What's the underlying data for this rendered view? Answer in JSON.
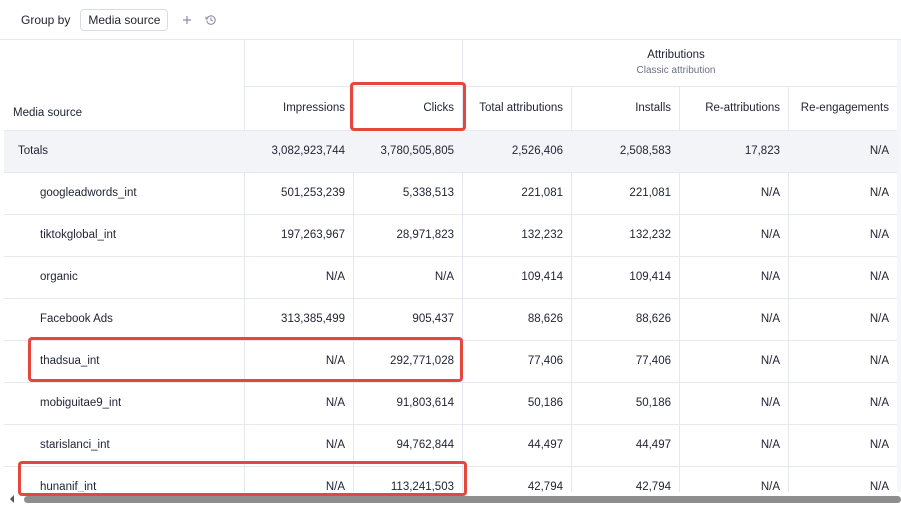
{
  "toolbar": {
    "group_by_label": "Group by",
    "group_by_value": "Media source",
    "add_icon": "plus-icon",
    "history_icon": "history-icon"
  },
  "table": {
    "attributions_title": "Attributions",
    "attributions_subtitle": "Classic attribution",
    "columns": {
      "media_source": "Media source",
      "impressions": "Impressions",
      "clicks": "Clicks",
      "total_attributions": "Total attributions",
      "installs": "Installs",
      "re_attributions": "Re-attributions",
      "re_engagements": "Re-engagements"
    },
    "totals": {
      "label": "Totals",
      "impressions": "3,082,923,744",
      "clicks": "3,780,505,805",
      "total_attributions": "2,526,406",
      "installs": "2,508,583",
      "re_attributions": "17,823",
      "re_engagements": "N/A"
    },
    "rows": [
      {
        "source": "googleadwords_int",
        "impressions": "501,253,239",
        "clicks": "5,338,513",
        "total_attributions": "221,081",
        "installs": "221,081",
        "re_attributions": "N/A",
        "re_engagements": "N/A"
      },
      {
        "source": "tiktokglobal_int",
        "impressions": "197,263,967",
        "clicks": "28,971,823",
        "total_attributions": "132,232",
        "installs": "132,232",
        "re_attributions": "N/A",
        "re_engagements": "N/A"
      },
      {
        "source": "organic",
        "impressions": "N/A",
        "clicks": "N/A",
        "total_attributions": "109,414",
        "installs": "109,414",
        "re_attributions": "N/A",
        "re_engagements": "N/A"
      },
      {
        "source": "Facebook Ads",
        "impressions": "313,385,499",
        "clicks": "905,437",
        "total_attributions": "88,626",
        "installs": "88,626",
        "re_attributions": "N/A",
        "re_engagements": "N/A"
      },
      {
        "source": "thadsua_int",
        "impressions": "N/A",
        "clicks": "292,771,028",
        "total_attributions": "77,406",
        "installs": "77,406",
        "re_attributions": "N/A",
        "re_engagements": "N/A"
      },
      {
        "source": "mobiguitae9_int",
        "impressions": "N/A",
        "clicks": "91,803,614",
        "total_attributions": "50,186",
        "installs": "50,186",
        "re_attributions": "N/A",
        "re_engagements": "N/A"
      },
      {
        "source": "starislanci_int",
        "impressions": "N/A",
        "clicks": "94,762,844",
        "total_attributions": "44,497",
        "installs": "44,497",
        "re_attributions": "N/A",
        "re_engagements": "N/A"
      },
      {
        "source": "hunanif_int",
        "impressions": "N/A",
        "clicks": "113,241,503",
        "total_attributions": "42,794",
        "installs": "42,794",
        "re_attributions": "N/A",
        "re_engagements": "N/A"
      }
    ],
    "highlight_color": "#e5473d"
  }
}
